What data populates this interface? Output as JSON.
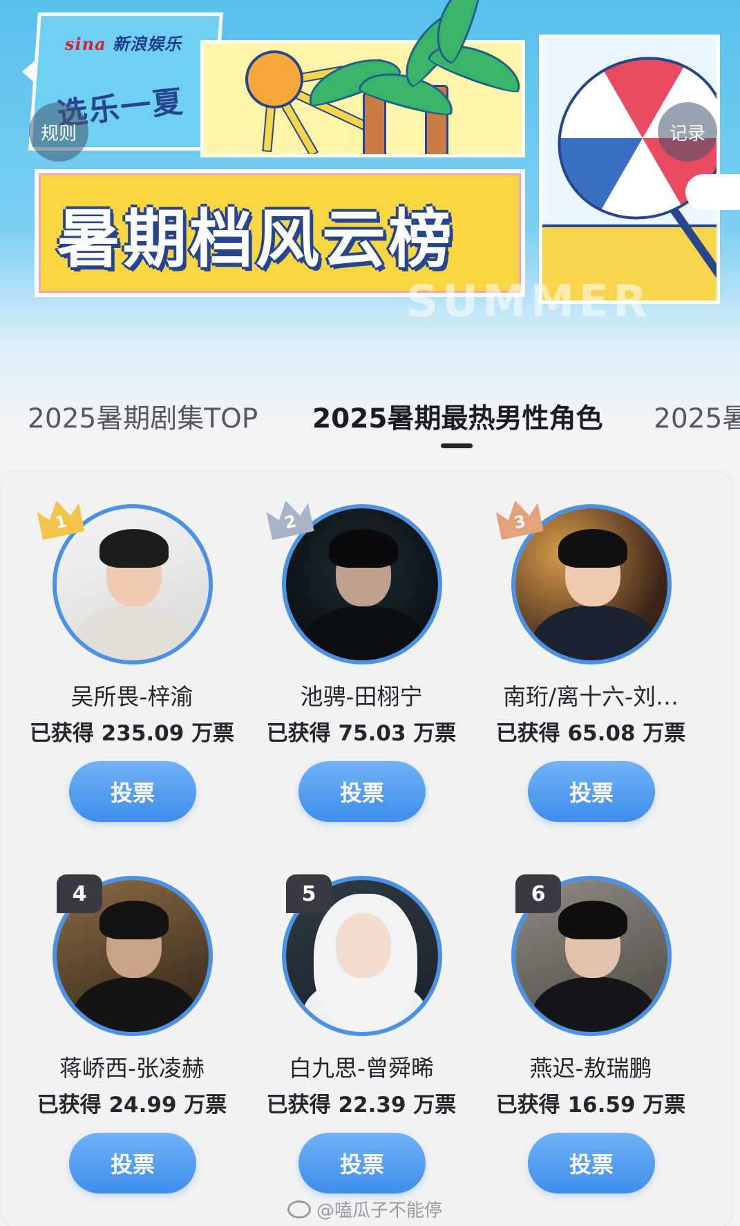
{
  "banner": {
    "brand_logo": "sina",
    "brand_name": "新浪娱乐",
    "slogan": "选乐一夏",
    "title": "暑期档风云榜",
    "watermark_word": "SUMMER",
    "rules_label": "规则",
    "record_label": "记录",
    "more_icon": "more-dots-icon"
  },
  "tabs": [
    {
      "label": "2025暑期剧集TOP",
      "active": false
    },
    {
      "label": "2025暑期最热男性角色",
      "active": true
    },
    {
      "label": "2025暑",
      "active": false
    }
  ],
  "colors": {
    "accent": "#4a92e6",
    "button_gradient_top": "#6fb2f6",
    "button_gradient_bottom": "#3f8ded",
    "gold": "#f3c34a",
    "silver": "#a9b3c8",
    "bronze": "#e3a27a"
  },
  "candidates": [
    {
      "rank": "1",
      "name": "吴所畏-梓渝",
      "votes": "已获得 235.09 万票",
      "button": "投票"
    },
    {
      "rank": "2",
      "name": "池骋-田栩宁",
      "votes": "已获得 75.03 万票",
      "button": "投票"
    },
    {
      "rank": "3",
      "name": "南珩/离十六-刘…",
      "votes": "已获得 65.08 万票",
      "button": "投票"
    },
    {
      "rank": "4",
      "name": "蒋峤西-张凌赫",
      "votes": "已获得 24.99 万票",
      "button": "投票"
    },
    {
      "rank": "5",
      "name": "白九思-曾舜晞",
      "votes": "已获得 22.39 万票",
      "button": "投票"
    },
    {
      "rank": "6",
      "name": "燕迟-敖瑞鹏",
      "votes": "已获得 16.59 万票",
      "button": "投票"
    }
  ],
  "footer": {
    "watermark": "@嗑瓜子不能停"
  }
}
